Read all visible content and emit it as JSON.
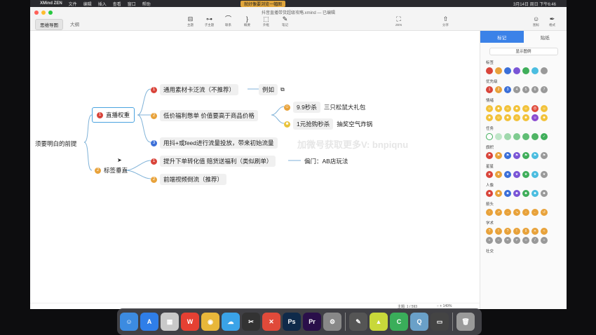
{
  "menubar": {
    "app": "XMind ZEN",
    "items": [
      "文件",
      "编辑",
      "插入",
      "查看",
      "窗口",
      "帮助"
    ],
    "center_text": "就好像要浏览一幅图",
    "clock": "3月14日 周日 下午6:46"
  },
  "window": {
    "doc_title": "抖音直播带货超级攻略.xmind — 已编辑",
    "view_tabs": [
      "思维导图",
      "大纲"
    ],
    "tools": [
      {
        "icon": "topic-icon",
        "glyph": "⊟",
        "label": "主题"
      },
      {
        "icon": "subtopic-icon",
        "glyph": "⊶",
        "label": "子主题"
      },
      {
        "icon": "relation-icon",
        "glyph": "⌒",
        "label": "联系"
      },
      {
        "icon": "summary-icon",
        "glyph": "}",
        "label": "概要"
      },
      {
        "icon": "boundary-icon",
        "glyph": "⬚",
        "label": "外框"
      },
      {
        "icon": "note-icon",
        "glyph": "✎",
        "label": "笔记"
      }
    ],
    "zen": {
      "glyph": "⛶",
      "label": "ZEN"
    },
    "share": {
      "glyph": "⇧",
      "label": "分享"
    },
    "icons_btn": {
      "glyph": "☺",
      "label": "图标"
    },
    "format_btn": {
      "glyph": "✒",
      "label": "格式"
    }
  },
  "mindmap": {
    "root": "须要明白的前提",
    "branches": [
      {
        "num": "1",
        "label": "直播权重"
      },
      {
        "num": "2",
        "label": "标签垂直"
      }
    ],
    "b1_children": [
      {
        "num": "1",
        "label": "通用素材卡泛流（不推荐）",
        "extra": "例如"
      },
      {
        "num": "2",
        "label": "低价福利憋单  价值要高于商品价格"
      },
      {
        "num": "3",
        "label": "用抖+或feed进行流量投放，带来初始流量"
      }
    ],
    "b1_sub": [
      {
        "label": "9.9秒杀",
        "detail": "三只松鼠大礼包"
      },
      {
        "label": "1元抢购秒杀",
        "detail": "抽奖空气炸锅"
      }
    ],
    "b2_children": [
      {
        "num": "1",
        "label": "提升下单转化值  赔货送福利（类似刷单）",
        "extra": "偏门：AB店玩法"
      },
      {
        "num": "2",
        "label": "前端视频倒流（推荐）"
      }
    ],
    "watermark": "加微号获取更多V: bnpiqnu"
  },
  "statusbar": {
    "topics": "主题: 1 / 593",
    "zoom": "149%"
  },
  "panel": {
    "tabs": [
      "标记",
      "贴纸"
    ],
    "legend_button": "显示图例",
    "groups": [
      "标签",
      "优先级",
      "情绪",
      "任务",
      "旗帜",
      "星星",
      "人像",
      "箭头",
      "学术",
      "社交"
    ],
    "tag_colors": [
      "#d9443a",
      "#e8a23a",
      "#3b6fd8",
      "#7a55d6",
      "#3fae5a",
      "#4bbde0",
      "#999999"
    ],
    "priority": [
      "1",
      "2",
      "3",
      "4",
      "5",
      "6",
      "7"
    ]
  },
  "dock": {
    "apps": [
      {
        "name": "finder",
        "color": "#3c8be0",
        "glyph": "☺"
      },
      {
        "name": "app-store",
        "color": "#2f7ee8",
        "glyph": "A"
      },
      {
        "name": "launchpad",
        "color": "#c9c9c9",
        "glyph": "▦"
      },
      {
        "name": "wps",
        "color": "#e54033",
        "glyph": "W"
      },
      {
        "name": "chrome",
        "color": "#e8b73a",
        "glyph": "◉"
      },
      {
        "name": "baidu-netdisk",
        "color": "#3aa3e8",
        "glyph": "☁"
      },
      {
        "name": "final-cut",
        "color": "#333",
        "glyph": "✂"
      },
      {
        "name": "xmind",
        "color": "#e04a3a",
        "glyph": "✕"
      },
      {
        "name": "photoshop",
        "color": "#0f2a4a",
        "glyph": "Ps"
      },
      {
        "name": "premiere",
        "color": "#2a0f4a",
        "glyph": "Pr"
      },
      {
        "name": "system-preferences",
        "color": "#888",
        "glyph": "⚙"
      },
      {
        "name": "script-editor",
        "color": "#555",
        "glyph": "✎"
      },
      {
        "name": "vpn",
        "color": "#c8d83a",
        "glyph": "▲"
      },
      {
        "name": "wechat-work",
        "color": "#3aae5a",
        "glyph": "C"
      },
      {
        "name": "quicktime",
        "color": "#6aa0c8",
        "glyph": "Q"
      },
      {
        "name": "terminal-app",
        "color": "#444",
        "glyph": "▭"
      },
      {
        "name": "trash",
        "color": "#9a9a9a",
        "glyph": "🗑"
      }
    ]
  }
}
